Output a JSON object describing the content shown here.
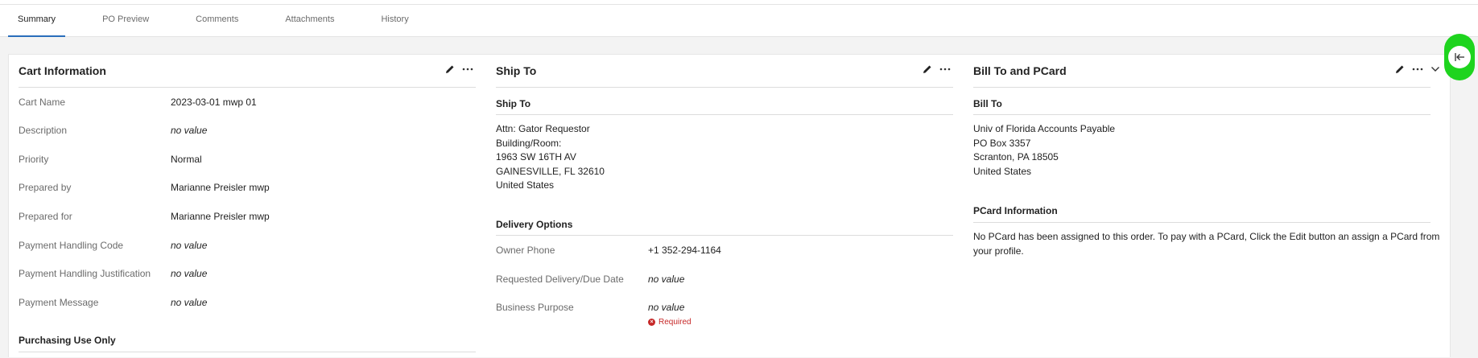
{
  "tabs": [
    {
      "label": "Summary"
    },
    {
      "label": "PO Preview"
    },
    {
      "label": "Comments"
    },
    {
      "label": "Attachments"
    },
    {
      "label": "History"
    }
  ],
  "cart_info": {
    "title": "Cart Information",
    "rows": [
      {
        "label": "Cart Name",
        "value": "2023-03-01 mwp 01"
      },
      {
        "label": "Description",
        "value": "no value"
      },
      {
        "label": "Priority",
        "value": "Normal"
      },
      {
        "label": "Prepared by",
        "value": "Marianne Preisler mwp"
      },
      {
        "label": "Prepared for",
        "value": "Marianne Preisler mwp"
      },
      {
        "label": "Payment Handling Code",
        "value": "no value"
      },
      {
        "label": "Payment Handling Justification",
        "value": "no value"
      },
      {
        "label": "Payment Message",
        "value": "no value"
      }
    ],
    "section2_title": "Purchasing Use Only"
  },
  "ship_to": {
    "title": "Ship To",
    "section_title": "Ship To",
    "address": [
      "Attn: Gator Requestor",
      "Building/Room:",
      "1963 SW 16TH AV",
      "GAINESVILLE, FL 32610",
      "United States"
    ],
    "delivery_title": "Delivery Options",
    "rows": [
      {
        "label": "Owner Phone",
        "value": "+1 352-294-1164"
      },
      {
        "label": "Requested Delivery/Due Date",
        "value": "no value"
      },
      {
        "label": "Business Purpose",
        "value": "no value"
      }
    ],
    "required_label": "Required"
  },
  "bill_to": {
    "title": "Bill To and PCard",
    "section_title": "Bill To",
    "address": [
      "Univ of Florida Accounts Payable",
      "PO Box 3357",
      "Scranton, PA 18505",
      "United States"
    ],
    "pcard_title": "PCard Information",
    "pcard_text": "No PCard has been assigned to this order. To pay with a PCard, Click the Edit button an assign a PCard from your profile."
  },
  "colors": {
    "accent": "#2a6ebb",
    "required": "#c62828",
    "highlight": "#1ed41e"
  },
  "icons": [
    "pencil-icon",
    "more-horizontal-icon",
    "chevron-down-icon",
    "collapse-left-icon",
    "error-circle-icon"
  ]
}
